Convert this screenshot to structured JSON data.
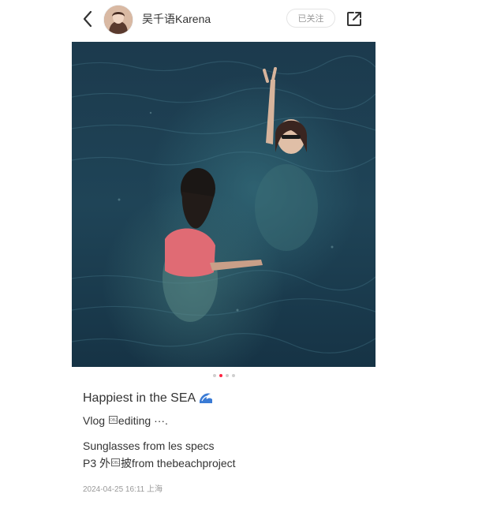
{
  "header": {
    "username": "吴千语Karena",
    "follow_label": "已关注"
  },
  "icons": {
    "back": "chevron-left-icon",
    "share": "share-icon",
    "wave": "water-wave-icon"
  },
  "carousel": {
    "total": 4,
    "active_index": 1
  },
  "post": {
    "title": "Happiest in the SEA",
    "line1_prefix": "Vlog ",
    "line1_suffix": "editing ···.",
    "line2": "Sunglasses from les specs",
    "line3_prefix": "P3 外",
    "line3_suffix": "披from thebeachproject",
    "timestamp": "2024-04-25 16:11",
    "location": "上海"
  },
  "colors": {
    "accent": "#ff2442",
    "text": "#333333",
    "muted": "#999999",
    "sea": "#1e3a4a"
  }
}
